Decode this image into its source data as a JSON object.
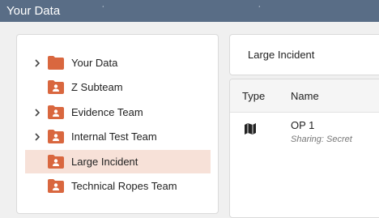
{
  "window": {
    "title": "Your Data"
  },
  "tree": {
    "items": [
      {
        "label": "Your Data",
        "expandable": true,
        "selected": false
      },
      {
        "label": "Z Subteam",
        "expandable": false,
        "selected": false
      },
      {
        "label": "Evidence Team",
        "expandable": true,
        "selected": false
      },
      {
        "label": "Internal Test Team",
        "expandable": true,
        "selected": false
      },
      {
        "label": "Large Incident",
        "expandable": false,
        "selected": true
      },
      {
        "label": "Technical Ropes Team",
        "expandable": false,
        "selected": false
      }
    ]
  },
  "detail": {
    "title": "Large Incident",
    "table": {
      "columns": [
        "Type",
        "Name"
      ],
      "rows": [
        {
          "type_icon": "map-icon",
          "name": "OP 1",
          "sharing": "Sharing: Secret"
        }
      ]
    }
  },
  "colors": {
    "titlebar": "#596d86",
    "folder": "#d9673f",
    "selected_row": "#f7e1d8"
  }
}
